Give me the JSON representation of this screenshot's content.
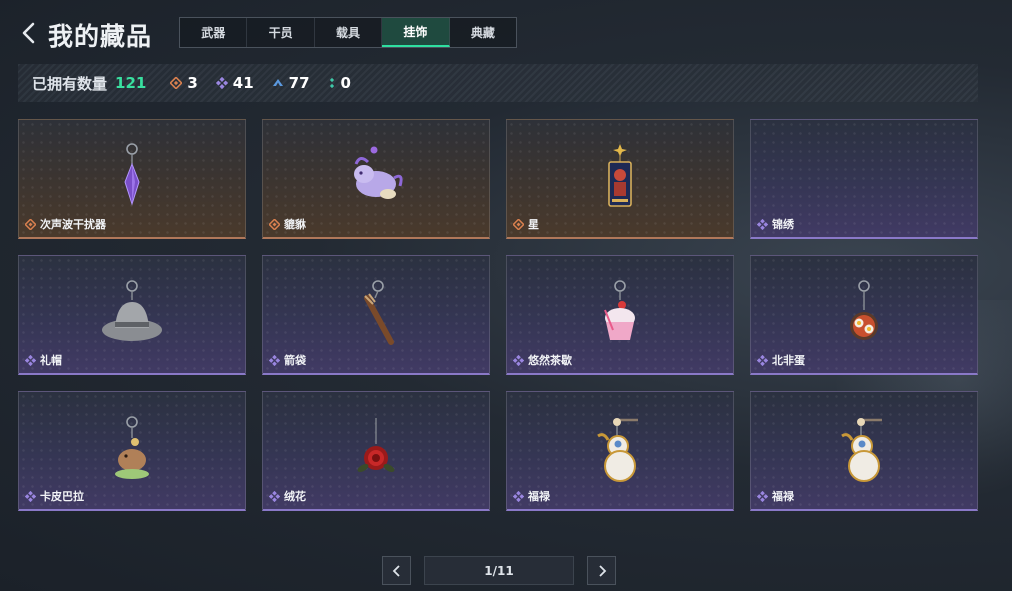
{
  "header": {
    "title": "我的藏品",
    "tabs": [
      {
        "label": "武器",
        "active": false
      },
      {
        "label": "干员",
        "active": false
      },
      {
        "label": "载具",
        "active": false
      },
      {
        "label": "挂饰",
        "active": true
      },
      {
        "label": "典藏",
        "active": false
      }
    ]
  },
  "stats": {
    "owned_label": "已拥有数量",
    "owned_total": "121",
    "rarities": [
      {
        "icon": "orange-diamond-icon",
        "color": "#d9804f",
        "count": "3"
      },
      {
        "icon": "purple-diamond-icon",
        "color": "#9a86e0",
        "count": "41"
      },
      {
        "icon": "blue-triangle-icon",
        "color": "#5b9ae0",
        "count": "77"
      },
      {
        "icon": "green-dots-icon",
        "color": "#3fc8a8",
        "count": "0"
      }
    ]
  },
  "items": [
    {
      "name": "次声波干扰器",
      "rarity": "orange",
      "icon": "purple-crystal-charm-icon"
    },
    {
      "name": "貔貅",
      "rarity": "orange",
      "icon": "purple-beast-charm-icon"
    },
    {
      "name": "星",
      "rarity": "orange",
      "icon": "tarot-card-charm-icon"
    },
    {
      "name": "锦绣",
      "rarity": "purple",
      "icon": "empty-charm-icon"
    },
    {
      "name": "礼帽",
      "rarity": "purple",
      "icon": "fedora-hat-charm-icon"
    },
    {
      "name": "箭袋",
      "rarity": "purple",
      "icon": "quiver-charm-icon"
    },
    {
      "name": "悠然茶歇",
      "rarity": "purple",
      "icon": "cupcake-charm-icon"
    },
    {
      "name": "北非蛋",
      "rarity": "purple",
      "icon": "shakshuka-charm-icon"
    },
    {
      "name": "卡皮巴拉",
      "rarity": "purple",
      "icon": "capybara-charm-icon"
    },
    {
      "name": "绒花",
      "rarity": "purple",
      "icon": "red-rose-charm-icon"
    },
    {
      "name": "福禄",
      "rarity": "purple",
      "icon": "gourd-charm-icon"
    },
    {
      "name": "福禄",
      "rarity": "purple",
      "icon": "gourd-charm-icon"
    }
  ],
  "pager": {
    "indicator": "1/11"
  }
}
